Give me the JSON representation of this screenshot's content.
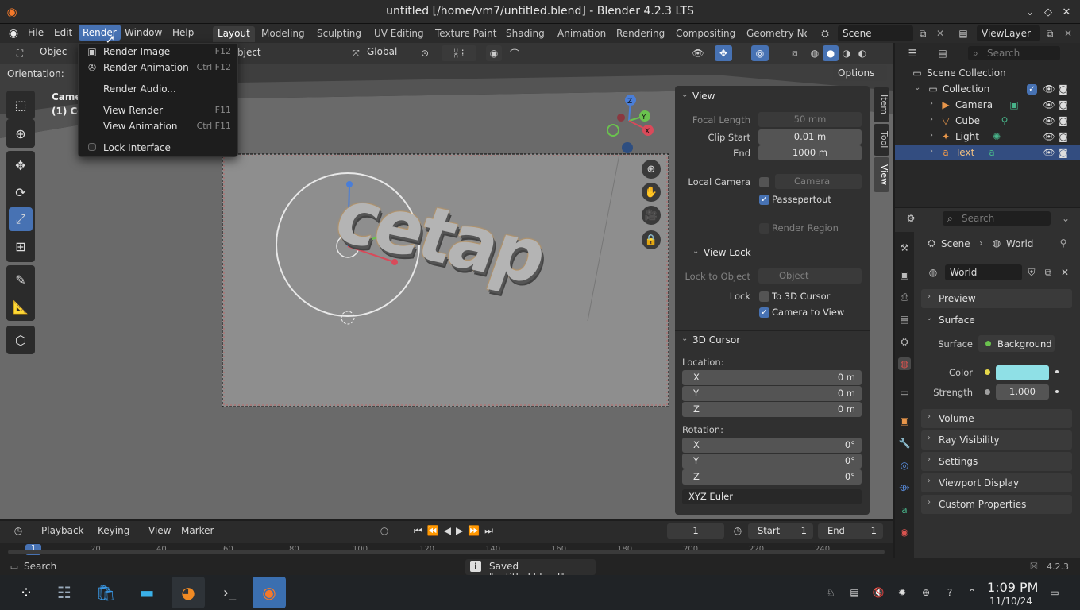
{
  "window": {
    "title": "untitled [/home/vm7/untitled.blend] - Blender 4.2.3 LTS"
  },
  "menubar": {
    "items": [
      "File",
      "Edit",
      "Render",
      "Window",
      "Help"
    ],
    "workspaces": [
      "Layout",
      "Modeling",
      "Sculpting",
      "UV Editing",
      "Texture Paint",
      "Shading",
      "Animation",
      "Rendering",
      "Compositing",
      "Geometry Noc"
    ],
    "scene": "Scene",
    "view_layer": "ViewLayer"
  },
  "render_menu": {
    "items": [
      {
        "label": "Render Image",
        "shortcut": "F12"
      },
      {
        "label": "Render Animation",
        "shortcut": "Ctrl F12"
      },
      {
        "label": "Render Audio...",
        "shortcut": ""
      },
      {
        "label": "View Render",
        "shortcut": "F11"
      },
      {
        "label": "View Animation",
        "shortcut": "Ctrl F11"
      },
      {
        "label": "Lock Interface",
        "shortcut": ""
      }
    ]
  },
  "viewport": {
    "mode_label": "Objec",
    "object_label": "bject",
    "orientation_label": "Orientation:",
    "transform_orientation": "Global",
    "options": "Options",
    "camera_info_1": "Camer",
    "camera_info_2": "(1) Co",
    "text_object": "cetap"
  },
  "npanel": {
    "tabs": [
      "Item",
      "Tool",
      "View"
    ],
    "view_section": "View",
    "focal_length_label": "Focal Length",
    "focal_length": "50 mm",
    "clip_start_label": "Clip Start",
    "clip_start": "0.01 m",
    "end_label": "End",
    "end": "1000 m",
    "local_camera_label": "Local Camera",
    "local_camera": "Camera",
    "passepartout": "Passepartout",
    "render_region": "Render Region",
    "view_lock_section": "View Lock",
    "lock_to_object_label": "Lock to Object",
    "lock_object": "Object",
    "lock_label": "Lock",
    "to_3d_cursor": "To 3D Cursor",
    "camera_to_view": "Camera to View",
    "cursor_section": "3D Cursor",
    "location_label": "Location:",
    "loc": [
      {
        "axis": "X",
        "value": "0 m"
      },
      {
        "axis": "Y",
        "value": "0 m"
      },
      {
        "axis": "Z",
        "value": "0 m"
      }
    ],
    "rotation_label": "Rotation:",
    "rot": [
      {
        "axis": "X",
        "value": "0°"
      },
      {
        "axis": "Y",
        "value": "0°"
      },
      {
        "axis": "Z",
        "value": "0°"
      }
    ],
    "rotation_mode": "XYZ Euler"
  },
  "outliner": {
    "search_placeholder": "Search",
    "scene_collection": "Scene Collection",
    "collection": "Collection",
    "objects": [
      "Camera",
      "Cube",
      "Light",
      "Text"
    ]
  },
  "properties": {
    "search_placeholder": "Search",
    "breadcrumb_scene": "Scene",
    "breadcrumb_world": "World",
    "world_name": "World",
    "preview": "Preview",
    "surface_section": "Surface",
    "surface_label": "Surface",
    "surface_value": "Background",
    "color_label": "Color",
    "color_value": "#8fe0e6",
    "strength_label": "Strength",
    "strength_value": "1.000",
    "sections": [
      "Volume",
      "Ray Visibility",
      "Settings",
      "Viewport Display",
      "Custom Properties"
    ]
  },
  "timeline": {
    "menus": [
      "Playback",
      "Keying",
      "View",
      "Marker"
    ],
    "current_frame": "1",
    "start_label": "Start",
    "start": "1",
    "end_label": "End",
    "end": "1",
    "ruler": [
      "1",
      "20",
      "40",
      "60",
      "80",
      "100",
      "120",
      "140",
      "160",
      "180",
      "200",
      "220",
      "240"
    ]
  },
  "statusbar": {
    "left": "Search",
    "message": "Saved \"untitled.blend\"",
    "version": "4.2.3"
  },
  "taskbar": {
    "time": "1:09 PM",
    "date": "11/10/24"
  }
}
